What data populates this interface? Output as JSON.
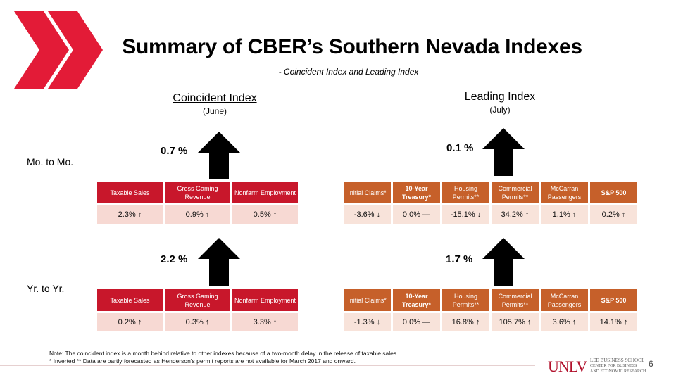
{
  "slide": {
    "title": "Summary of CBER’s Southern Nevada Indexes",
    "subtitle": "- Coincident Index and Leading Index",
    "page_number": "6"
  },
  "colors": {
    "brand_red": "#c8172b",
    "coincident_header": "#c8172b",
    "coincident_cell": "#f7d9d3",
    "leading_header": "#c6602a",
    "leading_cell": "#f8e3da"
  },
  "coincident": {
    "title": "Coincident Index",
    "period": "(June)",
    "mo_to_mo_value": "0.7 %",
    "yr_to_yr_value": "2.2 %",
    "mo_direction": "up-arrow-icon",
    "yr_direction": "up-arrow-icon",
    "columns": [
      "Taxable Sales",
      "Gross Gaming Revenue",
      "Nonfarm Employment"
    ],
    "mo_values": [
      "2.3% ↑",
      "0.9% ↑",
      "0.5% ↑"
    ],
    "yr_values": [
      "0.2% ↑",
      "0.3% ↑",
      "3.3% ↑"
    ]
  },
  "leading": {
    "title": "Leading Index",
    "period": "(July)",
    "mo_to_mo_value": "0.1 %",
    "yr_to_yr_value": "1.7 %",
    "mo_direction": "up-arrow-icon",
    "yr_direction": "up-arrow-icon",
    "columns": [
      "Initial Claims*",
      "10-Year Treasury*",
      "Housing Permits**",
      "Commercial Permits**",
      "McCarran Passengers",
      "S&P 500"
    ],
    "mo_values": [
      "-3.6% ↓",
      "0.0% —",
      "-15.1% ↓",
      "34.2% ↑",
      "1.1% ↑",
      "0.2% ↑"
    ],
    "yr_values": [
      "-1.3% ↓",
      "0.0% —",
      "16.8% ↑",
      "105.7% ↑",
      "3.6% ↑",
      "14.1% ↑"
    ]
  },
  "row_labels": {
    "mo": "Mo. to Mo.",
    "yr": "Yr. to Yr."
  },
  "notes": {
    "line1": "Note: The coincident index is a month behind relative to other indexes because of a two-month delay in the release of taxable sales.",
    "line2": "* Inverted  ** Data are partly forecasted as Henderson’s permit reports are not available for March 2017 and onward."
  },
  "footer": {
    "unlv": "UNLV",
    "school_line1": "LEE BUSINESS SCHOOL",
    "school_line2": "CENTER FOR BUSINESS",
    "school_line3": "AND ECONOMIC RESEARCH"
  }
}
